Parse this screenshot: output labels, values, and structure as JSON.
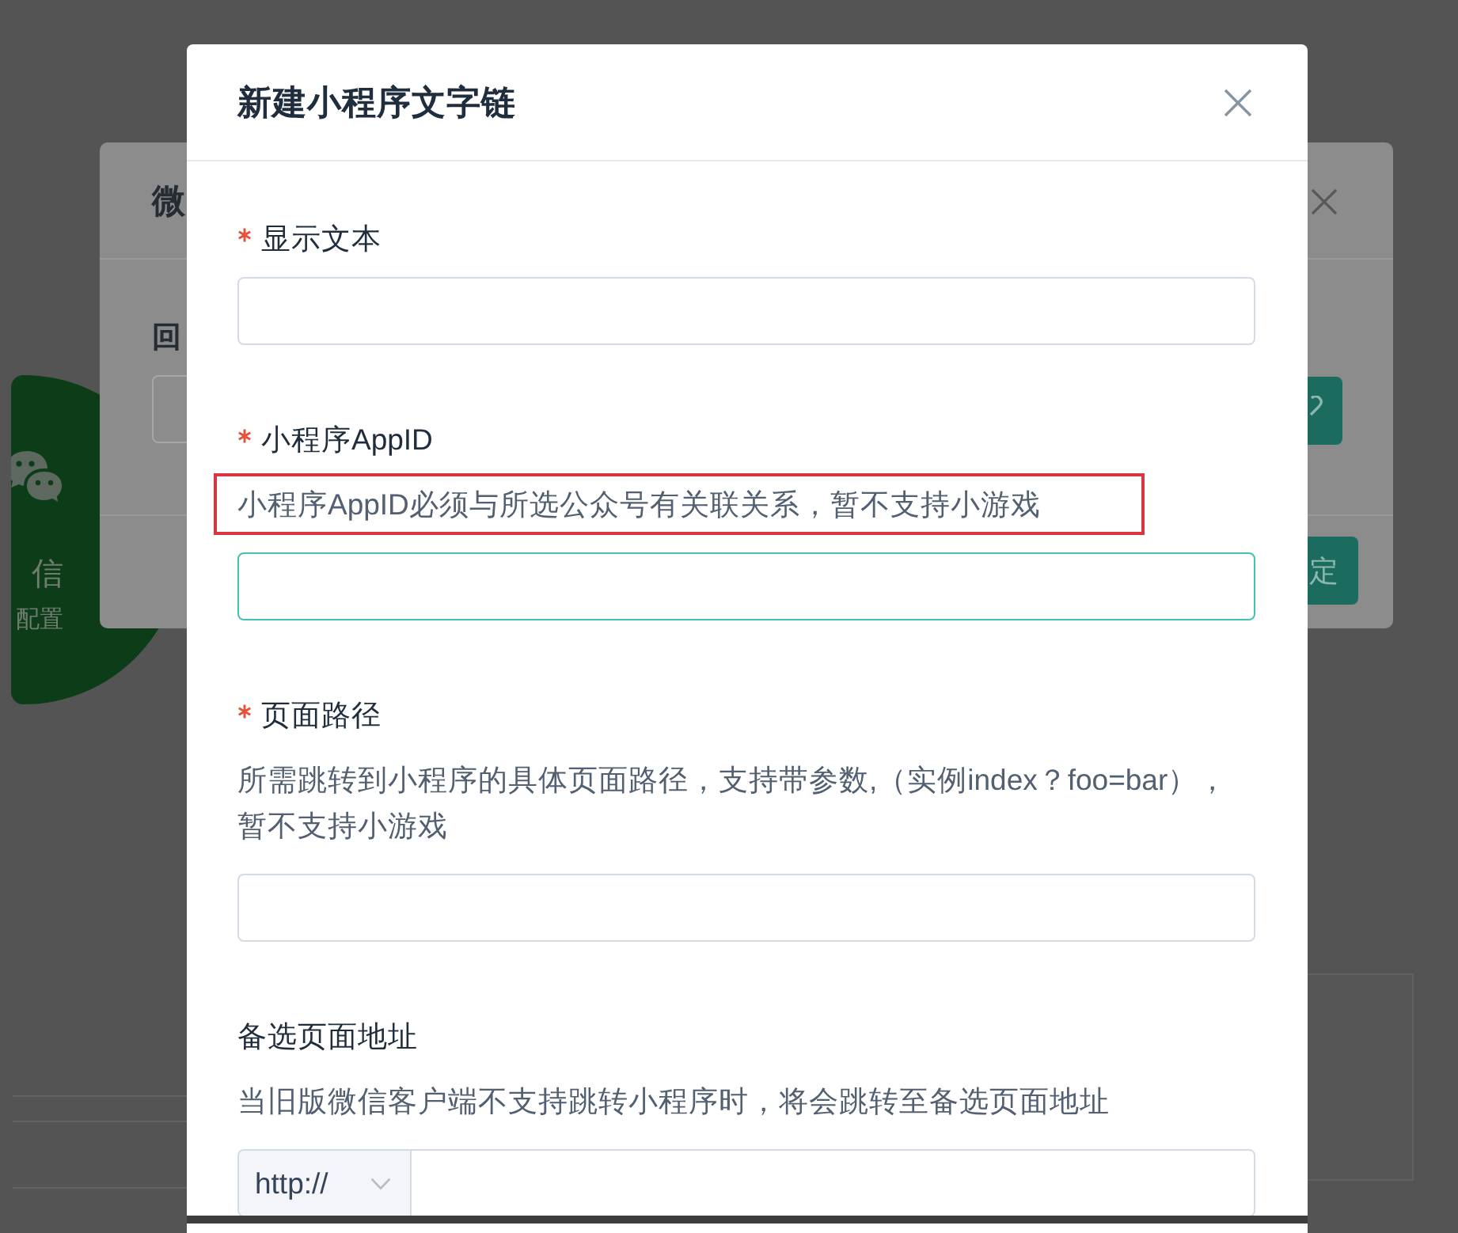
{
  "backdrop": {
    "badge": {
      "title": "信",
      "subtitle": "配置"
    },
    "dialog": {
      "title": "微",
      "field_label": "回",
      "confirm_button": "定"
    }
  },
  "dialog": {
    "title": "新建小程序文字链",
    "fields": [
      {
        "kind": "text",
        "label": "显示文本",
        "required": true,
        "focused": false
      },
      {
        "kind": "text",
        "label": "小程序AppID",
        "required": true,
        "hint": "小程序AppID必须与所选公众号有关联关系，暂不支持小游戏",
        "hint_highlighted": true,
        "focused": true
      },
      {
        "kind": "text",
        "label": "页面路径",
        "required": true,
        "hint": "所需跳转到小程序的具体页面路径，支持带参数,（实例index？foo=bar），暂不支持小游戏",
        "hint_highlighted": false,
        "focused": false
      },
      {
        "kind": "url",
        "label": "备选页面地址",
        "required": false,
        "hint": "当旧版微信客户端不支持跳转小程序时，将会跳转至备选页面地址",
        "hint_highlighted": false,
        "protocol": "http://",
        "focused": false
      }
    ]
  }
}
